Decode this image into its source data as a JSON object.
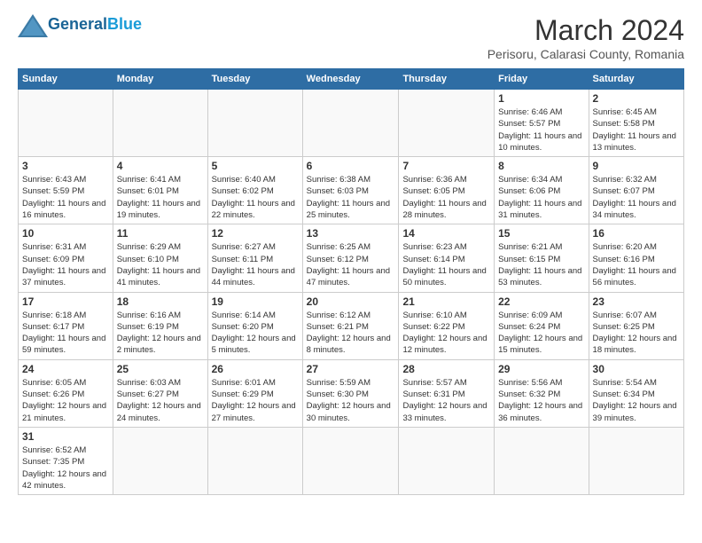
{
  "header": {
    "logo_general": "General",
    "logo_blue": "Blue",
    "title": "March 2024",
    "subtitle": "Perisoru, Calarasi County, Romania"
  },
  "weekdays": [
    "Sunday",
    "Monday",
    "Tuesday",
    "Wednesday",
    "Thursday",
    "Friday",
    "Saturday"
  ],
  "weeks": [
    [
      {
        "day": "",
        "info": ""
      },
      {
        "day": "",
        "info": ""
      },
      {
        "day": "",
        "info": ""
      },
      {
        "day": "",
        "info": ""
      },
      {
        "day": "",
        "info": ""
      },
      {
        "day": "1",
        "info": "Sunrise: 6:46 AM\nSunset: 5:57 PM\nDaylight: 11 hours and 10 minutes."
      },
      {
        "day": "2",
        "info": "Sunrise: 6:45 AM\nSunset: 5:58 PM\nDaylight: 11 hours and 13 minutes."
      }
    ],
    [
      {
        "day": "3",
        "info": "Sunrise: 6:43 AM\nSunset: 5:59 PM\nDaylight: 11 hours and 16 minutes."
      },
      {
        "day": "4",
        "info": "Sunrise: 6:41 AM\nSunset: 6:01 PM\nDaylight: 11 hours and 19 minutes."
      },
      {
        "day": "5",
        "info": "Sunrise: 6:40 AM\nSunset: 6:02 PM\nDaylight: 11 hours and 22 minutes."
      },
      {
        "day": "6",
        "info": "Sunrise: 6:38 AM\nSunset: 6:03 PM\nDaylight: 11 hours and 25 minutes."
      },
      {
        "day": "7",
        "info": "Sunrise: 6:36 AM\nSunset: 6:05 PM\nDaylight: 11 hours and 28 minutes."
      },
      {
        "day": "8",
        "info": "Sunrise: 6:34 AM\nSunset: 6:06 PM\nDaylight: 11 hours and 31 minutes."
      },
      {
        "day": "9",
        "info": "Sunrise: 6:32 AM\nSunset: 6:07 PM\nDaylight: 11 hours and 34 minutes."
      }
    ],
    [
      {
        "day": "10",
        "info": "Sunrise: 6:31 AM\nSunset: 6:09 PM\nDaylight: 11 hours and 37 minutes."
      },
      {
        "day": "11",
        "info": "Sunrise: 6:29 AM\nSunset: 6:10 PM\nDaylight: 11 hours and 41 minutes."
      },
      {
        "day": "12",
        "info": "Sunrise: 6:27 AM\nSunset: 6:11 PM\nDaylight: 11 hours and 44 minutes."
      },
      {
        "day": "13",
        "info": "Sunrise: 6:25 AM\nSunset: 6:12 PM\nDaylight: 11 hours and 47 minutes."
      },
      {
        "day": "14",
        "info": "Sunrise: 6:23 AM\nSunset: 6:14 PM\nDaylight: 11 hours and 50 minutes."
      },
      {
        "day": "15",
        "info": "Sunrise: 6:21 AM\nSunset: 6:15 PM\nDaylight: 11 hours and 53 minutes."
      },
      {
        "day": "16",
        "info": "Sunrise: 6:20 AM\nSunset: 6:16 PM\nDaylight: 11 hours and 56 minutes."
      }
    ],
    [
      {
        "day": "17",
        "info": "Sunrise: 6:18 AM\nSunset: 6:17 PM\nDaylight: 11 hours and 59 minutes."
      },
      {
        "day": "18",
        "info": "Sunrise: 6:16 AM\nSunset: 6:19 PM\nDaylight: 12 hours and 2 minutes."
      },
      {
        "day": "19",
        "info": "Sunrise: 6:14 AM\nSunset: 6:20 PM\nDaylight: 12 hours and 5 minutes."
      },
      {
        "day": "20",
        "info": "Sunrise: 6:12 AM\nSunset: 6:21 PM\nDaylight: 12 hours and 8 minutes."
      },
      {
        "day": "21",
        "info": "Sunrise: 6:10 AM\nSunset: 6:22 PM\nDaylight: 12 hours and 12 minutes."
      },
      {
        "day": "22",
        "info": "Sunrise: 6:09 AM\nSunset: 6:24 PM\nDaylight: 12 hours and 15 minutes."
      },
      {
        "day": "23",
        "info": "Sunrise: 6:07 AM\nSunset: 6:25 PM\nDaylight: 12 hours and 18 minutes."
      }
    ],
    [
      {
        "day": "24",
        "info": "Sunrise: 6:05 AM\nSunset: 6:26 PM\nDaylight: 12 hours and 21 minutes."
      },
      {
        "day": "25",
        "info": "Sunrise: 6:03 AM\nSunset: 6:27 PM\nDaylight: 12 hours and 24 minutes."
      },
      {
        "day": "26",
        "info": "Sunrise: 6:01 AM\nSunset: 6:29 PM\nDaylight: 12 hours and 27 minutes."
      },
      {
        "day": "27",
        "info": "Sunrise: 5:59 AM\nSunset: 6:30 PM\nDaylight: 12 hours and 30 minutes."
      },
      {
        "day": "28",
        "info": "Sunrise: 5:57 AM\nSunset: 6:31 PM\nDaylight: 12 hours and 33 minutes."
      },
      {
        "day": "29",
        "info": "Sunrise: 5:56 AM\nSunset: 6:32 PM\nDaylight: 12 hours and 36 minutes."
      },
      {
        "day": "30",
        "info": "Sunrise: 5:54 AM\nSunset: 6:34 PM\nDaylight: 12 hours and 39 minutes."
      }
    ],
    [
      {
        "day": "31",
        "info": "Sunrise: 6:52 AM\nSunset: 7:35 PM\nDaylight: 12 hours and 42 minutes."
      },
      {
        "day": "",
        "info": ""
      },
      {
        "day": "",
        "info": ""
      },
      {
        "day": "",
        "info": ""
      },
      {
        "day": "",
        "info": ""
      },
      {
        "day": "",
        "info": ""
      },
      {
        "day": "",
        "info": ""
      }
    ]
  ]
}
